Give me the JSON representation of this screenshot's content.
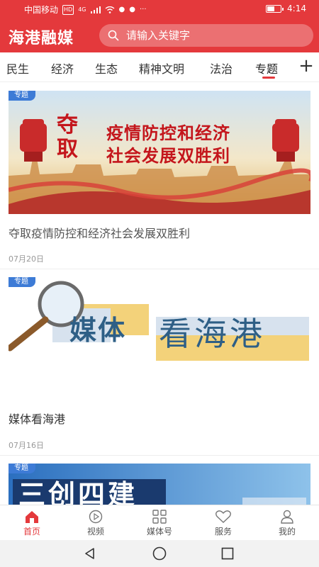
{
  "status_bar": {
    "carrier": "中国移动",
    "hd": "HD",
    "network": "4G",
    "time": "4:14",
    "battery_level": 0.55
  },
  "header": {
    "app_title": "海港融媒",
    "search_placeholder": "请输入关键字"
  },
  "tabs": {
    "items": [
      {
        "label": "民生"
      },
      {
        "label": "经济"
      },
      {
        "label": "生态"
      },
      {
        "label": "精神文明"
      },
      {
        "label": "法治"
      },
      {
        "label": "专题"
      }
    ],
    "active_index": 5
  },
  "feed": {
    "items": [
      {
        "tag": "专题",
        "banner_left": "夺取",
        "banner_line1": "疫情防控和经济",
        "banner_line2": "社会发展双胜利",
        "title": "夺取疫情防控和经济社会发展双胜利",
        "date": "07月20日"
      },
      {
        "tag": "专题",
        "banner_left": "媒体",
        "banner_right": "看海港",
        "title": "媒体看海港",
        "date": "07月16日"
      },
      {
        "tag": "专题",
        "banner_text": "三创四建"
      }
    ]
  },
  "bottom_nav": {
    "items": [
      {
        "label": "首页",
        "icon": "home-icon"
      },
      {
        "label": "视频",
        "icon": "play-icon"
      },
      {
        "label": "媒体号",
        "icon": "grid-icon"
      },
      {
        "label": "服务",
        "icon": "heart-icon"
      },
      {
        "label": "我的",
        "icon": "user-icon"
      }
    ],
    "active_index": 0
  },
  "colors": {
    "brand_red": "#e4393c",
    "tag_blue": "#3d7bd6"
  }
}
